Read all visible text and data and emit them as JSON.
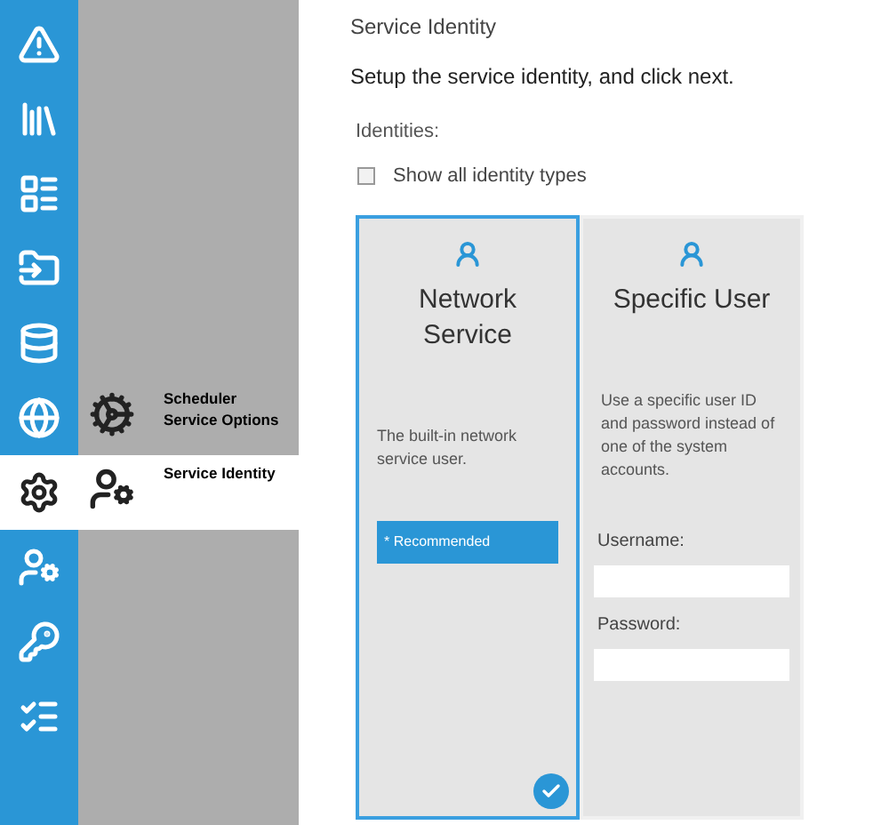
{
  "rail": [
    {
      "selected": false
    },
    {
      "selected": false
    },
    {
      "selected": false
    },
    {
      "selected": false
    },
    {
      "selected": false
    },
    {
      "selected": false,
      "subitem": {
        "label": "Scheduler Service Options",
        "selected": false
      }
    },
    {
      "selected": true,
      "subitem": {
        "label": "Service Identity",
        "selected": true
      }
    },
    {
      "selected": false
    },
    {
      "selected": false
    },
    {
      "selected": false
    }
  ],
  "page": {
    "title": "Service Identity",
    "instruction": "Setup the service identity, and click next.",
    "identities_label": "Identities:",
    "show_all": {
      "label": "Show all identity types",
      "checked": false
    }
  },
  "identities": [
    {
      "kind": "builtin",
      "title": "Network Service",
      "description": "The built-in network service user.",
      "badge": "* Recommended",
      "selected": true
    },
    {
      "kind": "user",
      "title": "Specific User",
      "description": "Use a specific user ID and password instead of one of the system accounts.",
      "fields": [
        {
          "label": "Username:"
        },
        {
          "label": "Password:"
        }
      ],
      "selected": false
    }
  ]
}
